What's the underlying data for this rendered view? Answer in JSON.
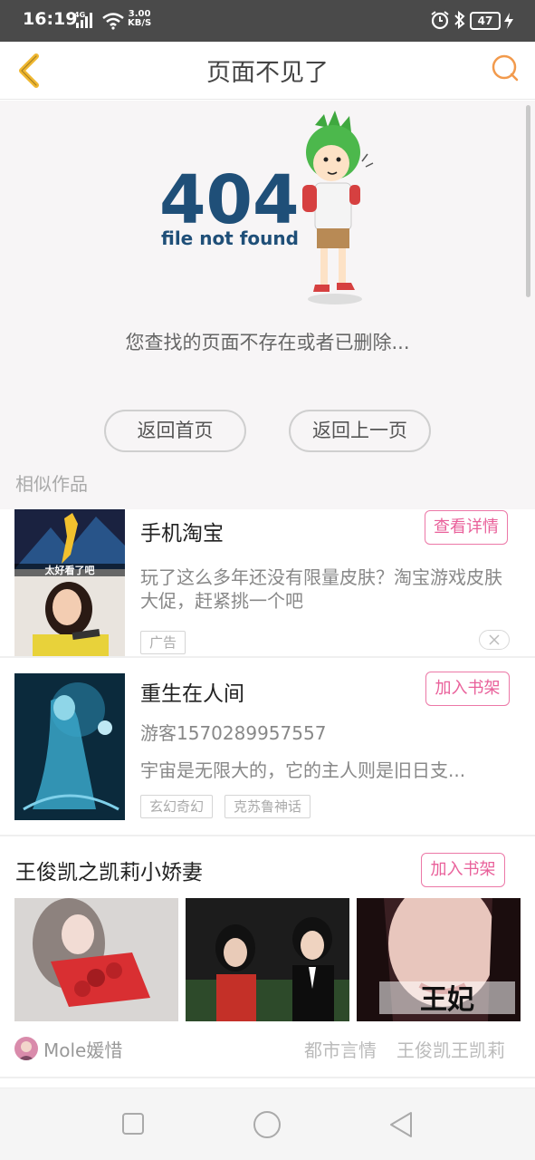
{
  "status_bar": {
    "time": "16:19",
    "network": "4G",
    "speed_value": "3.00",
    "speed_unit": "KB/S",
    "battery": "47"
  },
  "header": {
    "title": "页面不见了"
  },
  "error": {
    "code": "404",
    "subtitle": "file not found",
    "message": "您查找的页面不存在或者已删除...",
    "home_button": "返回首页",
    "back_button": "返回上一页"
  },
  "similar": {
    "title": "相似作品"
  },
  "ad": {
    "title": "手机淘宝",
    "button": "查看详情",
    "description": "玩了这么多年还没有限量皮肤？淘宝游戏皮肤大促，赶紧挑一个吧",
    "label": "广告",
    "thumb_caption": "太好看了吧"
  },
  "book1": {
    "title": "重生在人间",
    "button": "加入书架",
    "author": "游客1570289957557",
    "description": "宇宙是无限大的，它的主人则是旧日支...",
    "tags": [
      "玄幻奇幻",
      "克苏鲁神话"
    ]
  },
  "book2": {
    "title": "王俊凯之凯莉小娇妻",
    "button": "加入书架",
    "image3_caption": "王妃",
    "author": "Mole媛惜",
    "tags": [
      "都市言情",
      "王俊凯王凯莉"
    ]
  },
  "colors": {
    "accent_pink": "#e9609a",
    "back_arrow": "#f0b730",
    "search_icon": "#f29a4c",
    "error_blue": "#1f4f78"
  }
}
